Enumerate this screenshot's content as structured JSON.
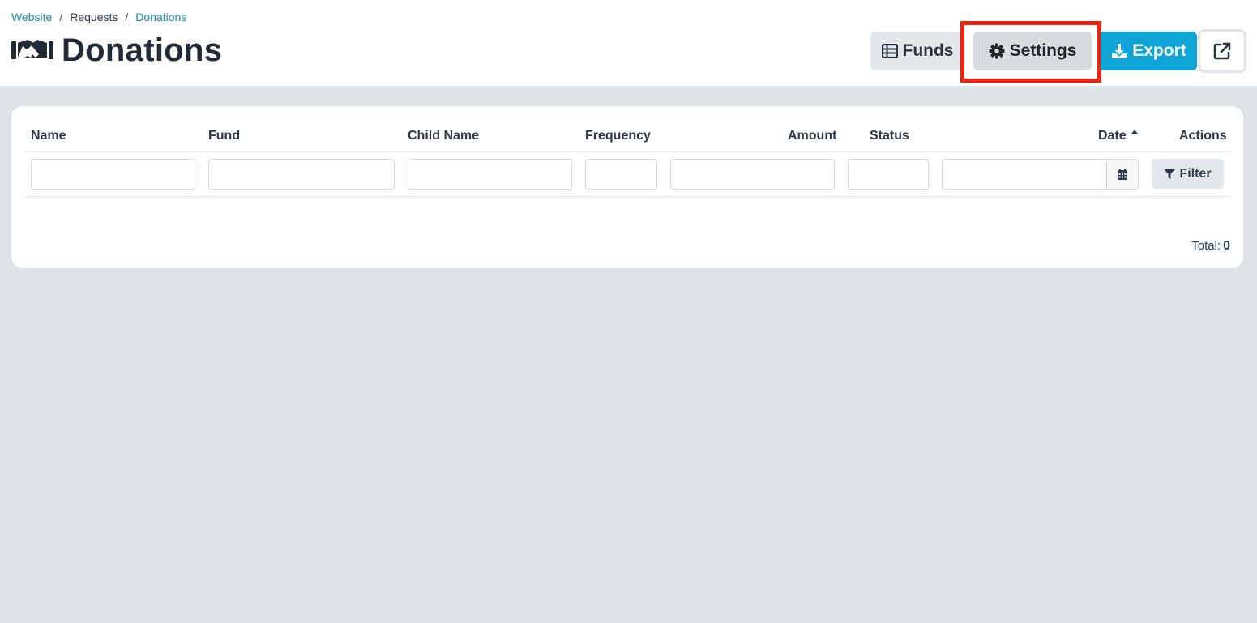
{
  "breadcrumb": {
    "items": [
      "Website",
      "Requests",
      "Donations"
    ],
    "separator": "/"
  },
  "page": {
    "title": "Donations"
  },
  "toolbar": {
    "funds_label": "Funds",
    "settings_label": "Settings",
    "export_label": "Export"
  },
  "table": {
    "columns": {
      "name": "Name",
      "fund": "Fund",
      "child_name": "Child Name",
      "frequency": "Frequency",
      "amount": "Amount",
      "status": "Status",
      "date": "Date",
      "actions": "Actions"
    },
    "filter_label": "Filter",
    "total_label": "Total:",
    "total_value": "0"
  },
  "colors": {
    "accent": "#1a8aa8",
    "export_button": "#0ea5d6",
    "highlight": "#f2230e",
    "background": "#dde3e6"
  },
  "icons": {
    "title": "handshake-icon",
    "funds": "table-list-icon",
    "settings": "gear-icon",
    "export": "download-icon",
    "external": "external-link-icon",
    "date_sort": "caret-up-icon",
    "calendar": "calendar-icon",
    "filter": "filter-funnel-icon"
  }
}
